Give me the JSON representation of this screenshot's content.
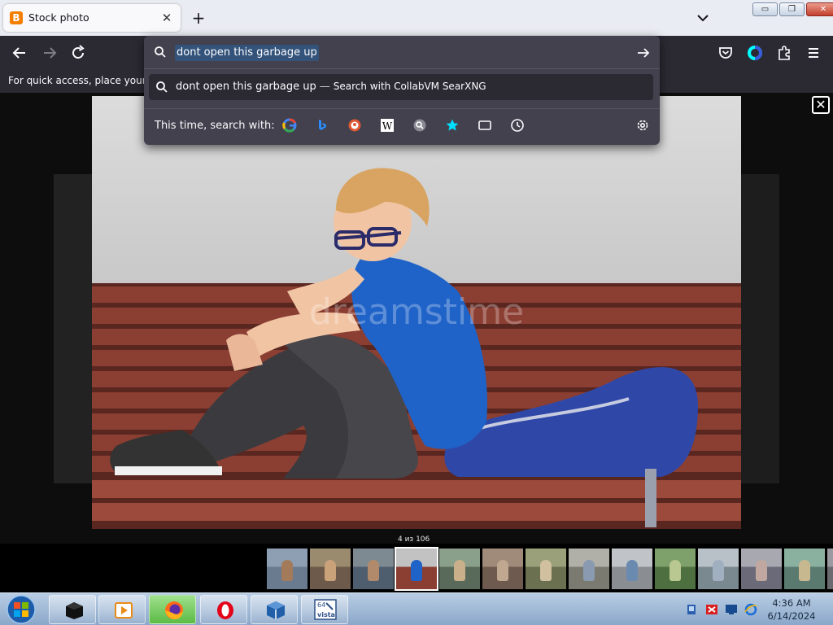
{
  "browser": {
    "tab": {
      "title": "Stock photo",
      "favicon_letter": "B"
    },
    "window_buttons": {
      "minimize": "▭",
      "restore": "❐",
      "close": "✕"
    },
    "bookmarks_hint": "For quick access, place your bookmarks here"
  },
  "urlbar": {
    "value": "dont open this garbage up",
    "suggestion": {
      "query": "dont open this garbage up",
      "separator": "—",
      "engine_text": "Search with CollabVM SearXNG"
    },
    "search_with_label": "This time, search with:",
    "engines": [
      "google-icon",
      "bing-icon",
      "duckduckgo-icon",
      "wikipedia-icon",
      "searxng-icon",
      "bookmarks-icon",
      "tabs-icon",
      "history-icon",
      "settings-icon"
    ],
    "wikipedia_letter": "W"
  },
  "viewer": {
    "close_glyph": "✕",
    "counter": "4 из 106",
    "watermark": "dreamstime",
    "thumbnails": 14,
    "active_thumbnail": 4
  },
  "taskbar": {
    "apps": [
      "terminal-icon",
      "media-player-icon",
      "firefox-icon",
      "opera-icon",
      "virtualbox-icon",
      "vista-icon"
    ],
    "vista_label": "vista",
    "vista_bits": "64",
    "clock": {
      "time": "4:36 AM",
      "date": "6/14/2024"
    }
  },
  "colors": {
    "toolbar": "#2b2a33",
    "dropdown": "#42414d",
    "accent": "#0060df",
    "shirt": "#1f63c8",
    "bench": "#8b3e32"
  }
}
